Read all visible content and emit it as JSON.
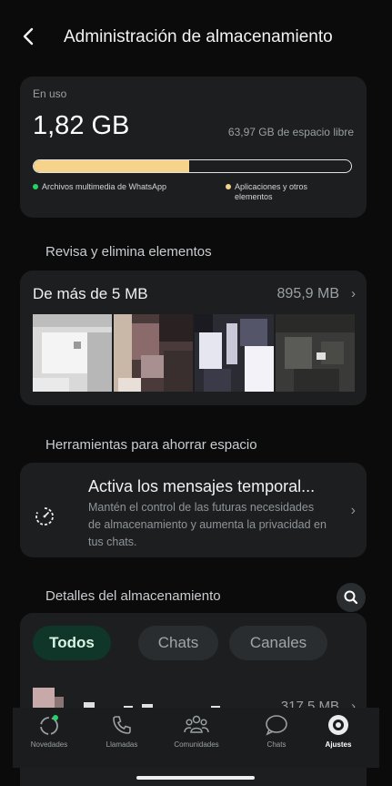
{
  "header": {
    "title": "Administración de almacenamiento",
    "back_icon": "chevron-left-icon"
  },
  "usage": {
    "in_use_label": "En uso",
    "used_value": "1,82 GB",
    "free_text": "63,97 GB de espacio libre",
    "bar_fill_fraction": 0.49,
    "legend": [
      {
        "label": "Archivos multimedia de WhatsApp",
        "color": "#25d366"
      },
      {
        "label": "Aplicaciones y otros elementos",
        "color": "#f5d38a"
      }
    ]
  },
  "review": {
    "section_title": "Revisa y elimina elementos",
    "card_title": "De más de 5 MB",
    "card_size": "895,9 MB",
    "chevron": "›"
  },
  "tools": {
    "section_title": "Herramientas para ahorrar espacio",
    "tip_title": "Activa los mensajes temporal...",
    "tip_description": "Mantén el control de las futuras necesidades de almacenamiento y aumenta la privacidad en tus chats.",
    "icon": "timer-icon",
    "chevron": "›"
  },
  "details": {
    "section_title": "Detalles del almacenamiento",
    "search_icon": "search-icon",
    "filters": [
      {
        "label": "Todos",
        "selected": true
      },
      {
        "label": "Chats",
        "selected": false
      },
      {
        "label": "Canales",
        "selected": false
      }
    ],
    "first_row_size": "317,5 MB",
    "chevron": "›"
  },
  "tabbar": {
    "items": [
      {
        "label": "Novedades",
        "icon": "status-icon",
        "active": false
      },
      {
        "label": "Llamadas",
        "icon": "phone-icon",
        "active": false
      },
      {
        "label": "Comunidades",
        "icon": "communities-icon",
        "active": false
      },
      {
        "label": "Chats",
        "icon": "chat-bubble-icon",
        "active": false
      },
      {
        "label": "Ajustes",
        "icon": "settings-icon",
        "active": true
      }
    ]
  },
  "colors": {
    "background": "#0b0b0b",
    "card": "#1c1e1f",
    "accent_green": "#25d366",
    "accent_yellow": "#f5d38a",
    "selected_chip": "#103529"
  }
}
